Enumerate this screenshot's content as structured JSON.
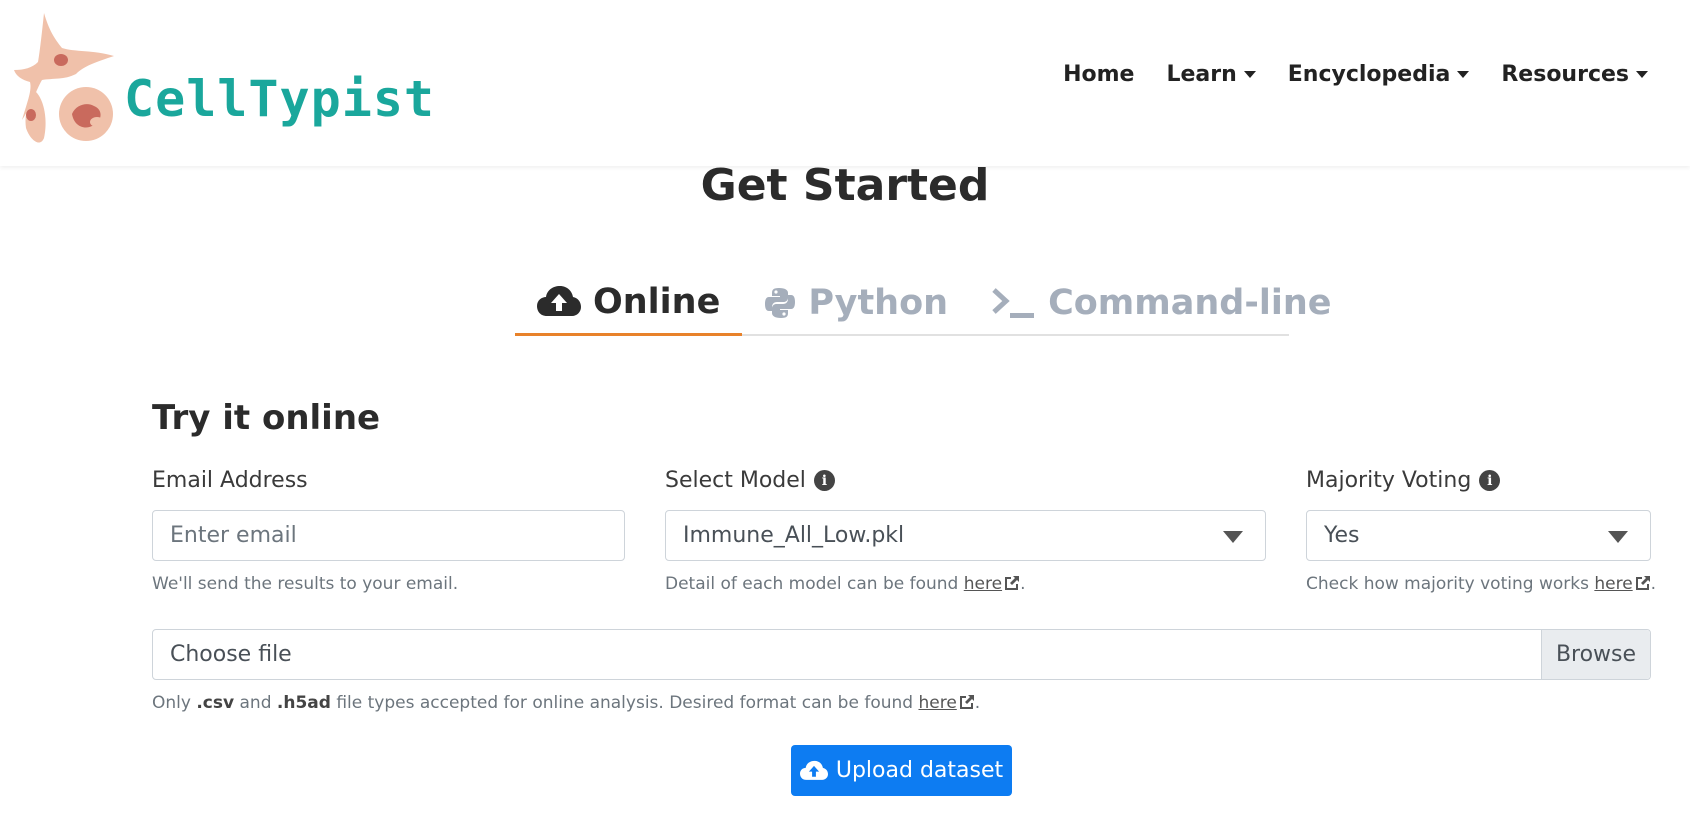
{
  "brand": {
    "name": "CellTypist",
    "color": "#1aa79c"
  },
  "nav": {
    "home": "Home",
    "learn": "Learn",
    "encyclopedia": "Encyclopedia",
    "resources": "Resources"
  },
  "page": {
    "title": "Get Started"
  },
  "tabs": [
    {
      "label": "Online",
      "icon": "cloud-upload-icon",
      "active": true
    },
    {
      "label": "Python",
      "icon": "python-icon",
      "active": false
    },
    {
      "label": "Command-line",
      "icon": "terminal-icon",
      "active": false
    }
  ],
  "form": {
    "section_title": "Try it online",
    "email": {
      "label": "Email Address",
      "placeholder": "Enter email",
      "value": "",
      "help": "We'll send the results to your email."
    },
    "model": {
      "label": "Select Model",
      "selected": "Immune_All_Low.pkl",
      "help_prefix": "Detail of each model can be found ",
      "help_link": "here",
      "help_suffix": "."
    },
    "voting": {
      "label": "Majority Voting",
      "selected": "Yes",
      "help_prefix": "Check how majority voting works ",
      "help_link": "here",
      "help_suffix": "."
    },
    "file": {
      "label": "Choose file",
      "browse": "Browse",
      "help_1": "Only ",
      "ext_csv": ".csv",
      "help_2": " and ",
      "ext_h5ad": ".h5ad",
      "help_3": " file types accepted for online analysis. Desired format can be found ",
      "help_link": "here",
      "help_suffix": "."
    },
    "upload_label": "Upload dataset"
  },
  "colors": {
    "accent_tab": "#e8822a",
    "primary_button": "#0d7cf2",
    "inactive_tab": "#a5aebb"
  }
}
